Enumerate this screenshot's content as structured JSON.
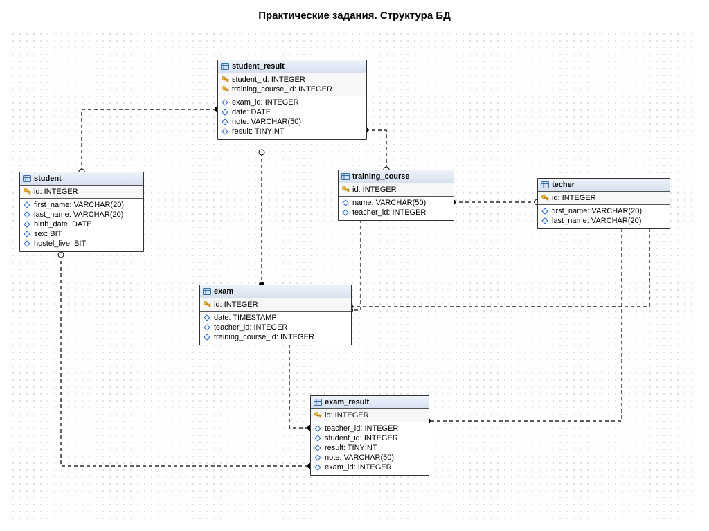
{
  "page_title": "Практические задания. Структура БД",
  "tables": {
    "student": {
      "name": "student",
      "pk": [
        "id: INTEGER"
      ],
      "cols": [
        "first_name: VARCHAR(20)",
        "last_name: VARCHAR(20)",
        "birth_date: DATE",
        "sex: BIT",
        "hostel_live: BIT"
      ]
    },
    "student_result": {
      "name": "student_result",
      "pk": [
        "student_id: INTEGER",
        "training_course_id: INTEGER"
      ],
      "cols": [
        "exam_id: INTEGER",
        "date: DATE",
        "note: VARCHAR(50)",
        "result: TINYINT"
      ]
    },
    "training_course": {
      "name": "training_course",
      "pk": [
        "id: INTEGER"
      ],
      "cols": [
        "name: VARCHAR(50)",
        "teacher_id: INTEGER"
      ]
    },
    "techer": {
      "name": "techer",
      "pk": [
        "id: INTEGER"
      ],
      "cols": [
        "first_name: VARCHAR(20)",
        "last_name: VARCHAR(20)"
      ]
    },
    "exam": {
      "name": "exam",
      "pk": [
        "id: INTEGER"
      ],
      "cols": [
        "date: TIMESTAMP",
        "teacher_id: INTEGER",
        "training_course_id: INTEGER"
      ]
    },
    "exam_result": {
      "name": "exam_result",
      "pk": [
        "id: INTEGER"
      ],
      "cols": [
        "teacher_id: INTEGER",
        "student_id: INTEGER",
        "result: TINYINT",
        "note: VARCHAR(50)",
        "exam_id: INTEGER"
      ]
    }
  }
}
